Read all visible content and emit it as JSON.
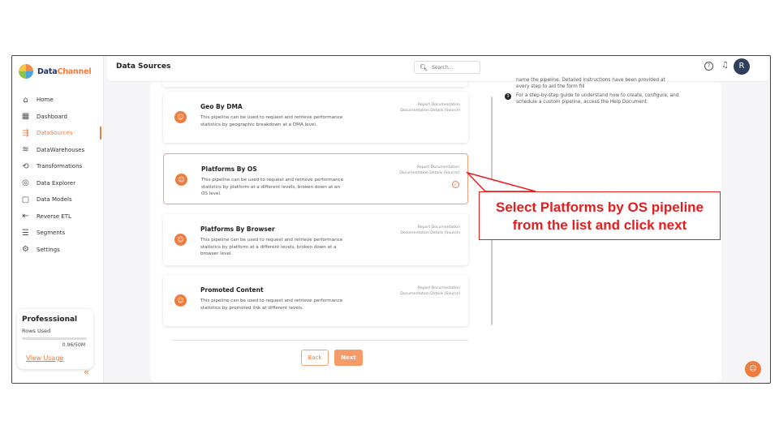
{
  "app": {
    "brand_part1": "Data",
    "brand_part2": "Channel"
  },
  "header": {
    "title": "Data Sources",
    "search_placeholder": "Search...",
    "avatar_initial": "R"
  },
  "sidebar": {
    "items": [
      {
        "label": "Home",
        "icon": "home-icon"
      },
      {
        "label": "Dashboard",
        "icon": "dashboard-icon"
      },
      {
        "label": "DataSources",
        "icon": "datasources-icon",
        "active": true
      },
      {
        "label": "DataWarehouses",
        "icon": "database-icon"
      },
      {
        "label": "Transformations",
        "icon": "transform-icon"
      },
      {
        "label": "Data Explorer",
        "icon": "explorer-icon"
      },
      {
        "label": "Data Models",
        "icon": "models-icon"
      },
      {
        "label": "Reverse ETL",
        "icon": "reverse-etl-icon"
      },
      {
        "label": "Segments",
        "icon": "segments-icon"
      },
      {
        "label": "Settings",
        "icon": "settings-icon"
      }
    ],
    "plan": {
      "title": "Professsional",
      "rows_label": "Rows Used",
      "value": "0.96/50M",
      "link": "View Usage"
    }
  },
  "pipelines": [
    {
      "title": "Geo By DMA",
      "desc": "This pipeline can be used to request and retrieve performance statistics by geographic breakdown at a DMA level.",
      "link1": "Report Documentation",
      "link2": "Documentation Details (Source)"
    },
    {
      "title": "Platforms By OS",
      "desc": "This pipeline can be used to request and retrieve performance statistics by platform at a different levels, broken down at an OS level.",
      "link1": "Report Documentation",
      "link2": "Documentation Details (Source)",
      "selected": true
    },
    {
      "title": "Platforms By Browser",
      "desc": "This pipeline can be used to request and retrieve performance statistics by platform at a different levels, broken down at a browser level.",
      "link1": "Report Documentation",
      "link2": "Documentation Details (Source)"
    },
    {
      "title": "Promoted Content",
      "desc": "This pipeline can be used to request and retrieve performance statistics by promoted link at different levels.",
      "link1": "Report Documentation",
      "link2": "Documentation Details (Source)"
    }
  ],
  "buttons": {
    "back": "Back",
    "next": "Next"
  },
  "instructions": {
    "line1": "name the pipeline. Detailed instructions have been provided at",
    "line2": "every step to aid the form fill",
    "item3_num": "3",
    "item3": "For a step-by-step guide to understand how to create, configure, and schedule a custom pipeline, access the Help Document."
  },
  "annotation": {
    "line1": "Select Platforms by OS pipeline",
    "line2": "from the list and click next"
  },
  "colors": {
    "accent": "#f07b3f",
    "annotation": "#e21e1e"
  }
}
